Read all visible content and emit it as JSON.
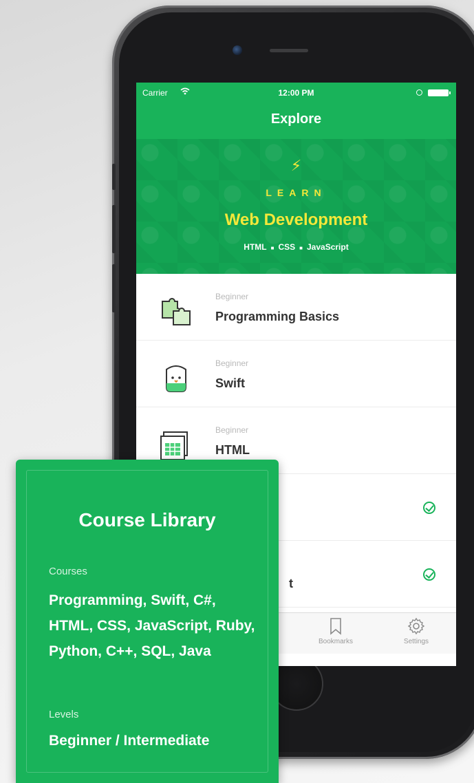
{
  "status_bar": {
    "carrier": "Carrier",
    "time": "12:00 PM"
  },
  "nav_bar": {
    "title": "Explore"
  },
  "hero": {
    "eyebrow": "LEARN",
    "headline": "Web Development",
    "tech": [
      "HTML",
      "CSS",
      "JavaScript"
    ],
    "accent_color": "#f4e83a"
  },
  "courses": [
    {
      "level": "Beginner",
      "name": "Programming Basics",
      "icon": "puzzle-icon",
      "completed": false
    },
    {
      "level": "Beginner",
      "name": "Swift",
      "icon": "swift-bird-icon",
      "completed": false
    },
    {
      "level": "Beginner",
      "name": "HTML",
      "icon": "html-browser-icon",
      "completed": false
    },
    {
      "level": "",
      "name": "",
      "icon": "",
      "completed": true
    },
    {
      "level": "",
      "name": "t",
      "icon": "",
      "completed": true
    }
  ],
  "tab_bar": {
    "bookmarks": "Bookmarks",
    "settings": "Settings"
  },
  "library_card": {
    "title": "Course Library",
    "courses_heading": "Courses",
    "courses_text": "Programming,  Swift, C#, HTML, CSS, JavaScript, Ruby, Python, C++, SQL, Java",
    "levels_heading": "Levels",
    "levels_text": "Beginner / Intermediate"
  },
  "colors": {
    "brand_green": "#19b35a",
    "hero_green": "#13a453"
  }
}
